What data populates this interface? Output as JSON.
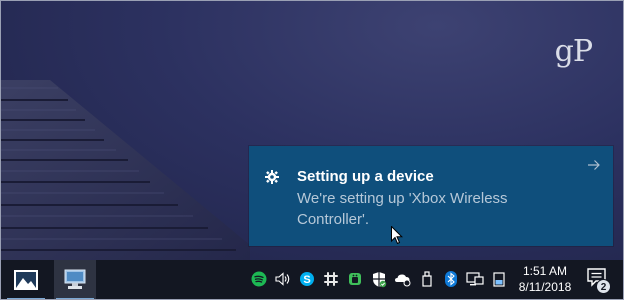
{
  "watermark": "gP",
  "toast": {
    "title": "Setting up a device",
    "body": "We're setting up 'Xbox Wireless Controller'.",
    "icon": "gear-icon",
    "arrow_icon": "arrow-right-icon",
    "background": "#0f4f7c"
  },
  "taskbar": {
    "apps": [
      {
        "name": "photos-app",
        "icon": "photos-icon"
      },
      {
        "name": "this-pc-app",
        "icon": "computer-icon"
      }
    ],
    "tray": [
      {
        "name": "spotify-icon"
      },
      {
        "name": "volume-icon"
      },
      {
        "name": "skype-icon"
      },
      {
        "name": "slack-icon"
      },
      {
        "name": "android-icon"
      },
      {
        "name": "defender-shield-icon"
      },
      {
        "name": "onedrive-sync-icon"
      },
      {
        "name": "usb-eject-icon"
      },
      {
        "name": "bluetooth-icon"
      },
      {
        "name": "network-icon"
      },
      {
        "name": "battery-icon"
      }
    ],
    "clock": {
      "time": "1:51 AM",
      "date": "8/11/2018"
    },
    "notifications": {
      "count": "2"
    }
  }
}
